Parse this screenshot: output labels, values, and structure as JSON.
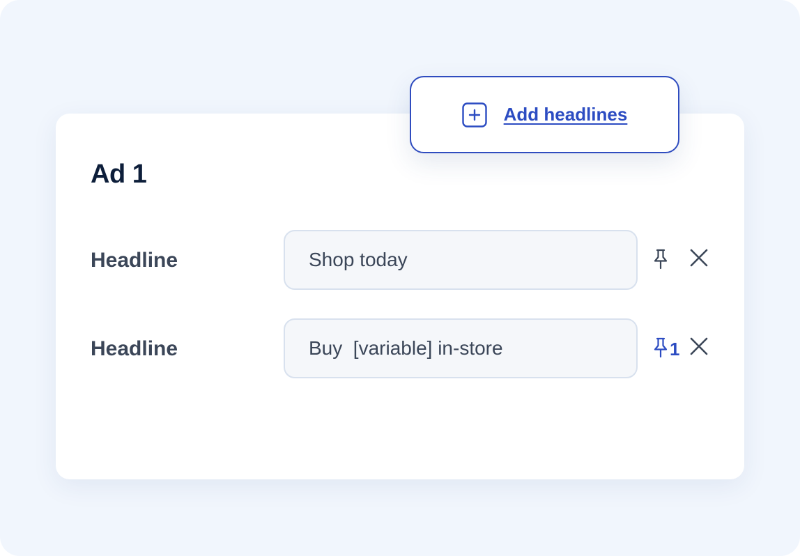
{
  "card": {
    "title": "Ad 1"
  },
  "rows": [
    {
      "label": "Headline",
      "value": "Shop today",
      "pinned": false,
      "pin_count": ""
    },
    {
      "label": "Headline",
      "value": "Buy  [variable] in-store",
      "pinned": true,
      "pin_count": "1"
    }
  ],
  "add_popup": {
    "label": "Add headlines",
    "icon": "plus-square-icon"
  },
  "colors": {
    "background": "#f1f6fd",
    "accent": "#2c4cc2",
    "text_primary": "#0d1e3a",
    "text_secondary": "#3b4658",
    "field_border": "#d8e1ee",
    "field_background": "#f5f7fa"
  }
}
